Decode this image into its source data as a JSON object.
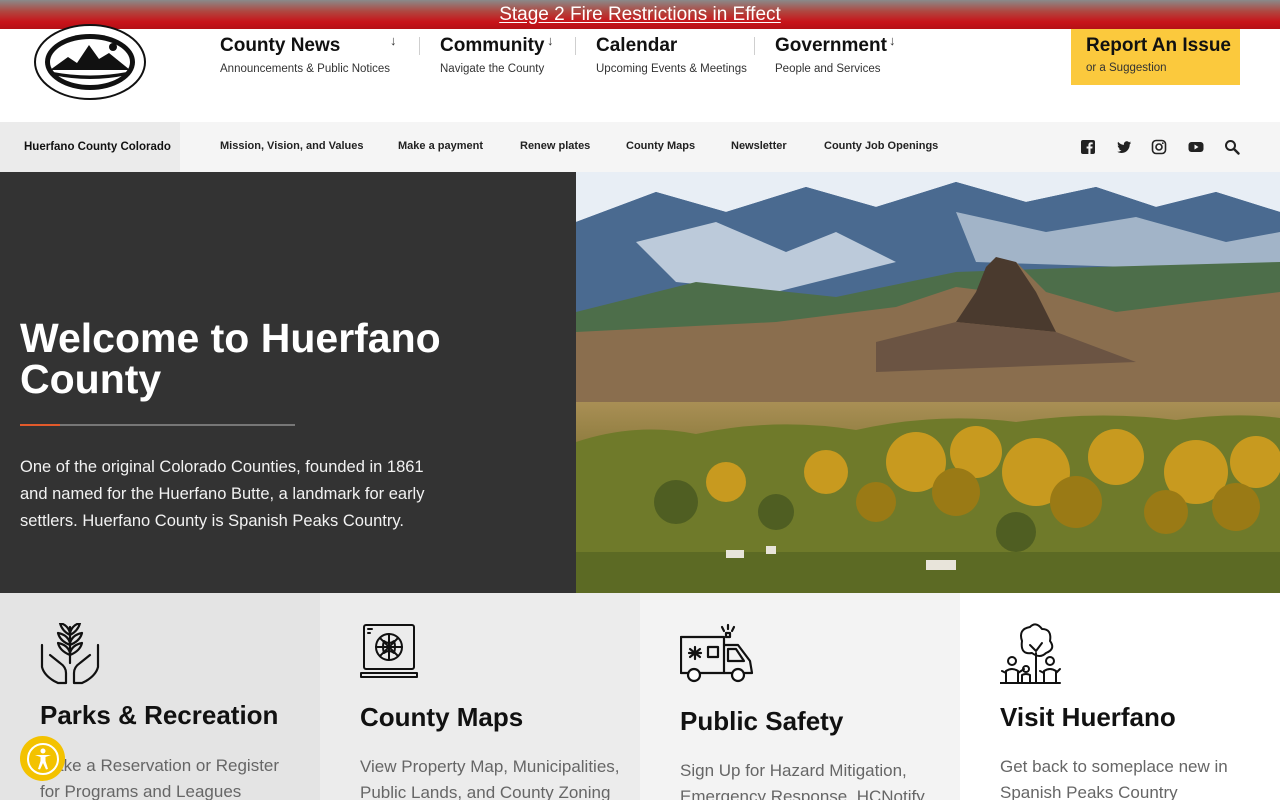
{
  "alert": {
    "text": "Stage 2 Fire Restrictions in Effect"
  },
  "nav": {
    "items": [
      {
        "title": "County News",
        "sub": "Announcements & Public Notices"
      },
      {
        "title": "Community",
        "sub": "Navigate the County"
      },
      {
        "title": "Calendar",
        "sub": "Upcoming Events & Meetings"
      },
      {
        "title": "Government",
        "sub": "People and Services"
      }
    ],
    "report": {
      "title": "Report An Issue",
      "sub": "or a Suggestion"
    }
  },
  "subnav": {
    "brand": "Huerfano County Colorado",
    "links": [
      "Mission, Vision, and Values",
      "Make a payment",
      "Renew plates",
      "County Maps",
      "Newsletter",
      "County Job Openings"
    ]
  },
  "hero": {
    "title": "Welcome to Huerfano County",
    "text": "One of the original Colorado Counties, founded in 1861 and named for the Huerfano Butte, a landmark for early settlers. Huerfano County is Spanish Peaks Country."
  },
  "cards": [
    {
      "title": "Parks & Recreation",
      "desc": "Make a Reservation or Register for Programs and Leagues",
      "icon": "hands-plant-icon"
    },
    {
      "title": "County Maps",
      "desc": "View Property Map, Municipalities, Public Lands, and County Zoning",
      "icon": "map-laptop-icon"
    },
    {
      "title": "Public Safety",
      "desc": "Sign Up for Hazard Mitigation, Emergency Response, HCNotify",
      "icon": "ambulance-icon"
    },
    {
      "title": "Visit Huerfano",
      "desc": "Get back to someplace new in Spanish Peaks Country",
      "icon": "family-tree-icon"
    }
  ],
  "colors": {
    "alert_red": "#c8141a",
    "report_yellow": "#fbc93d",
    "hero_dark": "#333333",
    "accent_orange": "#e25a2b"
  }
}
